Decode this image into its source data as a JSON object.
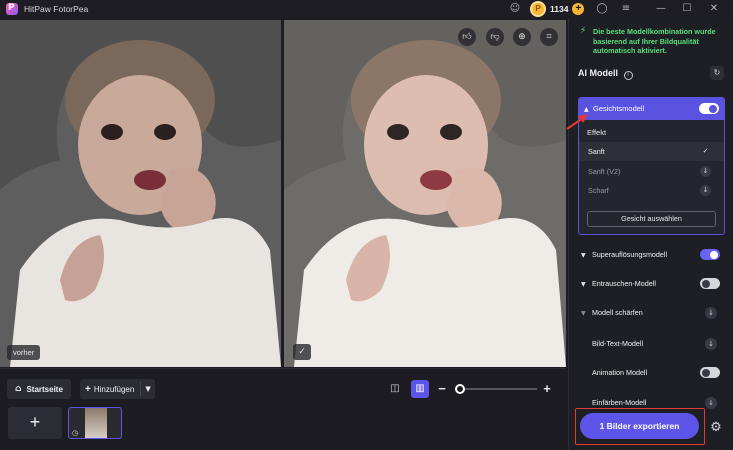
{
  "app": {
    "title": "HitPaw FotorPea",
    "coins": "1134"
  },
  "titlebar_icons": [
    "discord-icon",
    "coin-icon",
    "plus-icon",
    "menu-icon",
    "user-icon",
    "minimize-icon",
    "maximize-icon",
    "close-icon"
  ],
  "preview": {
    "before_label": "vorher",
    "tools": [
      "thumbs-up-icon",
      "thumbs-down-icon",
      "zoom-in-icon",
      "crop-icon"
    ]
  },
  "bottom": {
    "home_label": "Startseite",
    "add_label": "Hinzufügen",
    "add_tile": "+",
    "zoom_minus": "−",
    "zoom_plus": "+",
    "zoom_level": 0.06
  },
  "panel": {
    "notice": "Die beste Modellkombination wurde basierend auf Ihrer Bildqualität automatisch aktiviert.",
    "ai_title": "AI Modell",
    "face_model": {
      "label": "Gesichtsmodell",
      "enabled": true,
      "effect_title": "Effekt",
      "options": [
        {
          "label": "Sanft",
          "state": "selected"
        },
        {
          "label": "Sanft (V2)",
          "state": "download"
        },
        {
          "label": "Scharf",
          "state": "download"
        }
      ],
      "select_face_label": "Gesicht auswählen"
    },
    "models": [
      {
        "label": "Superauflösungsmodell",
        "control": "toggle-on"
      },
      {
        "label": "Entrauschen-Modell",
        "control": "toggle-off"
      },
      {
        "label": "Modell schärfen",
        "control": "download"
      },
      {
        "label": "Bild-Text-Modell",
        "control": "download"
      },
      {
        "label": "Animation Modell",
        "control": "toggle-off"
      },
      {
        "label": "Einfärben-Modell",
        "control": "download"
      }
    ],
    "export_label": "1 Bilder exportieren"
  },
  "colors": {
    "accent": "#5d55e8",
    "notice_green": "#59e07a",
    "highlight_red": "#e53935"
  }
}
